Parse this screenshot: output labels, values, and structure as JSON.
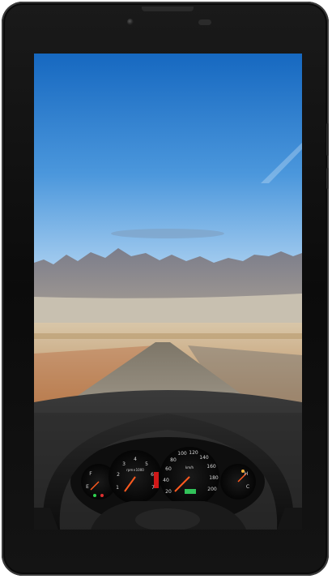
{
  "device": {
    "type": "tablet",
    "bezel_color": "#111111",
    "screen_content": "wallpaper"
  },
  "wallpaper": {
    "subject": "desert road viewed from car dashboard",
    "sky_top": "#1a6fc4",
    "sky_bottom": "#8cc3ee",
    "mountain_color": "#8a8a95",
    "sand_color": "#c9a77a",
    "road_color": "#8a8170"
  },
  "dashboard": {
    "left_gauge_ticks": [
      "1",
      "2",
      "3",
      "4",
      "5",
      "6",
      "7"
    ],
    "left_gauge_unit": "rpm×1000",
    "speed_ticks": [
      "20",
      "40",
      "60",
      "80",
      "100",
      "120",
      "140",
      "160",
      "180",
      "200"
    ],
    "speed_unit": "km/h",
    "fuel_labels": [
      "E",
      "F"
    ],
    "temp_labels": [
      "C",
      "H"
    ]
  }
}
